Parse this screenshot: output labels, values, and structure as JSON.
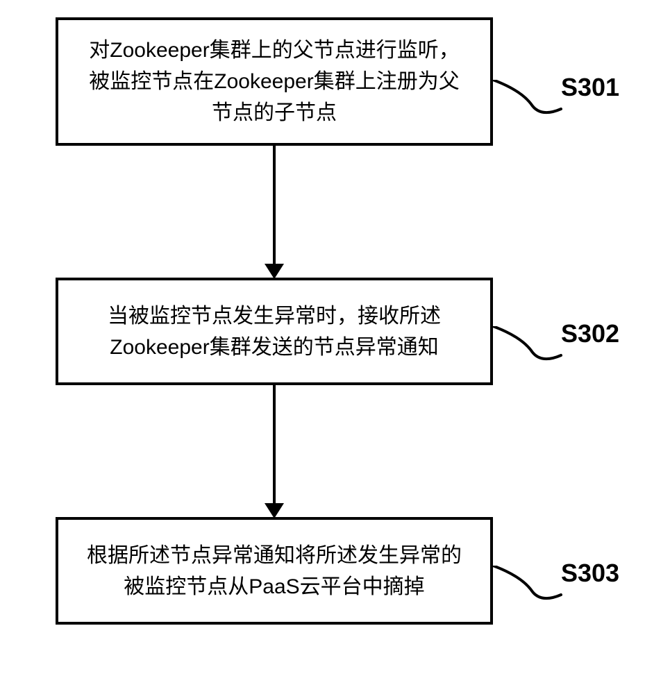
{
  "steps": [
    {
      "id": "S301",
      "text": "对Zookeeper集群上的父节点进行监听，被监控节点在Zookeeper集群上注册为父节点的子节点"
    },
    {
      "id": "S302",
      "text": "当被监控节点发生异常时，接收所述Zookeeper集群发送的节点异常通知"
    },
    {
      "id": "S303",
      "text": "根据所述节点异常通知将所述发生异常的被监控节点从PaaS云平台中摘掉"
    }
  ]
}
